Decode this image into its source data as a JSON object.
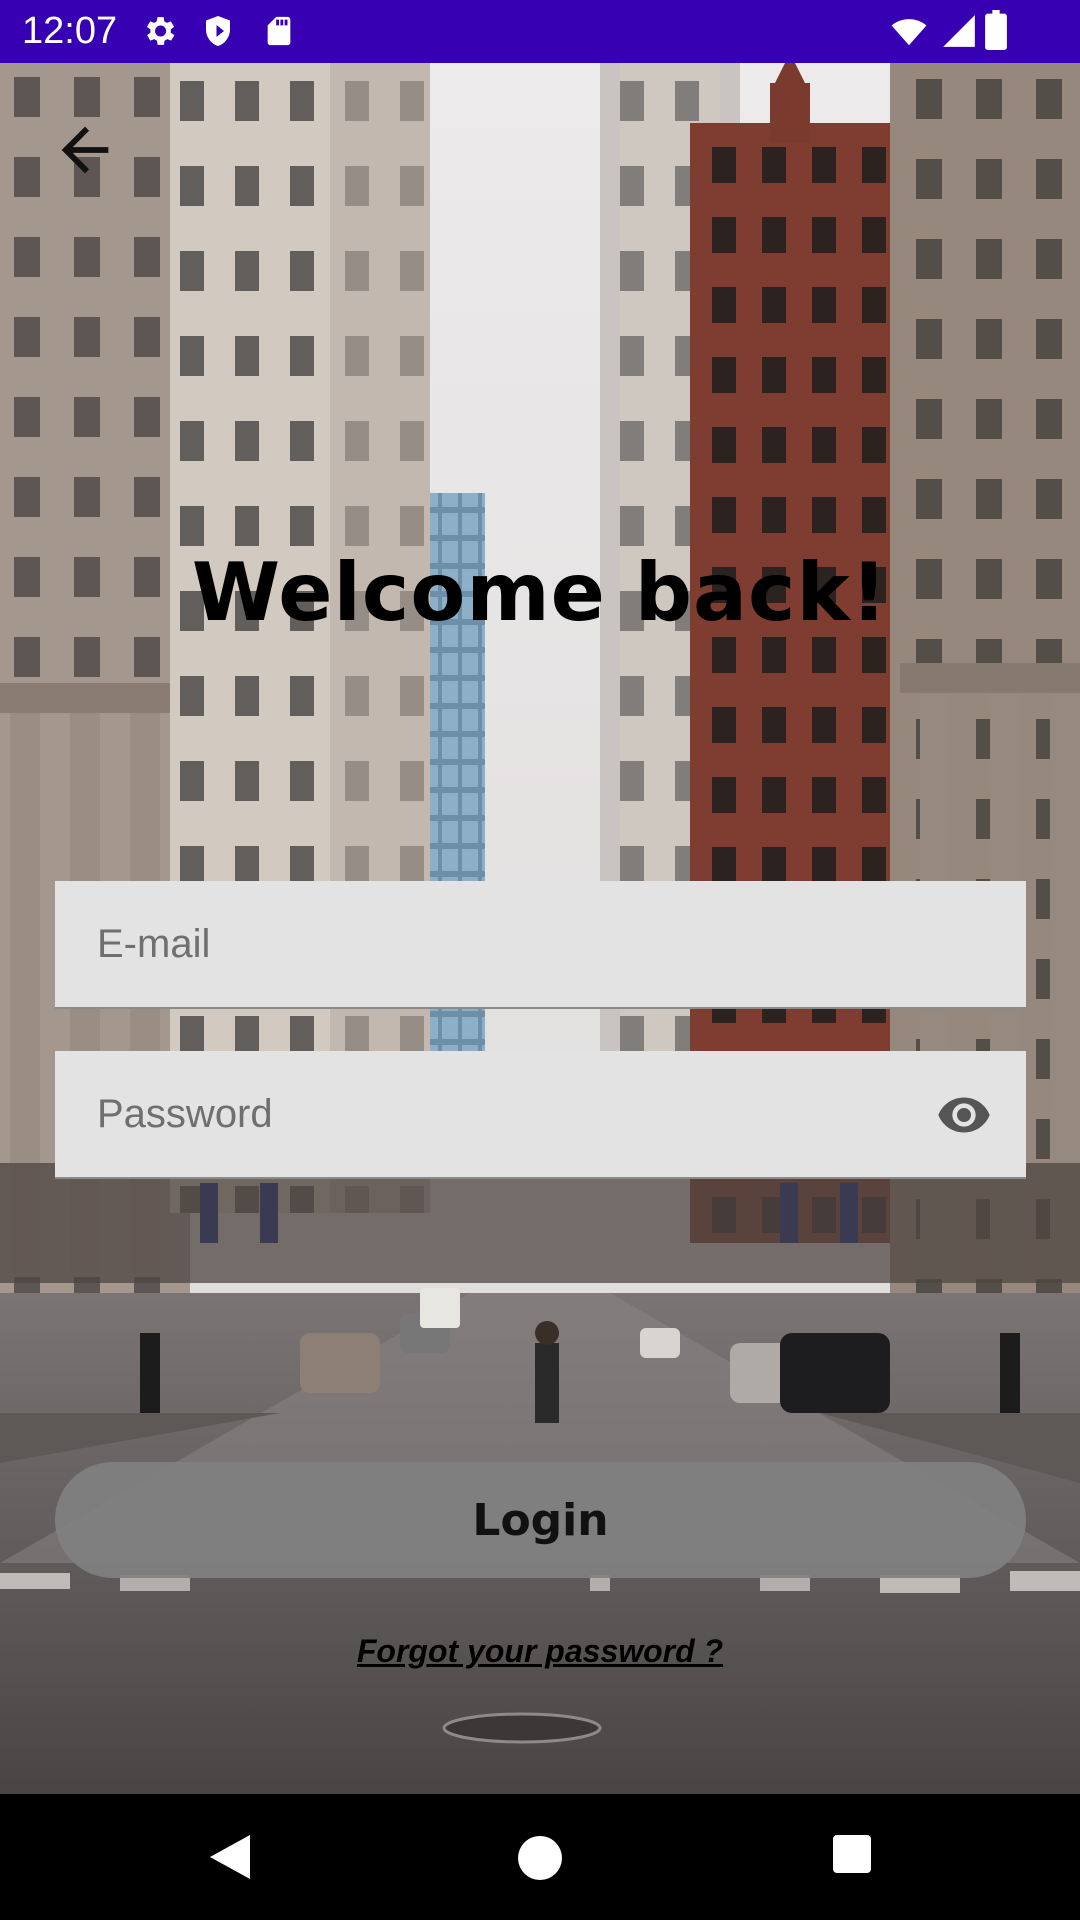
{
  "status_bar": {
    "time": "12:07",
    "icons": [
      "gear-icon",
      "shield-icon",
      "sd-card-icon",
      "wifi-icon",
      "cell-signal-icon",
      "battery-icon"
    ],
    "background_color": "#3700b3"
  },
  "app": {
    "back_icon": "arrow-left-icon",
    "title": "Welcome back!",
    "email": {
      "placeholder": "E-mail",
      "value": ""
    },
    "password": {
      "placeholder": "Password",
      "value": "",
      "toggle_icon": "eye-icon"
    },
    "login_label": "Login",
    "forgot_label": "Forgot your password ?"
  },
  "nav_bar": {
    "icons": [
      "nav-back-icon",
      "nav-home-icon",
      "nav-recents-icon"
    ]
  }
}
